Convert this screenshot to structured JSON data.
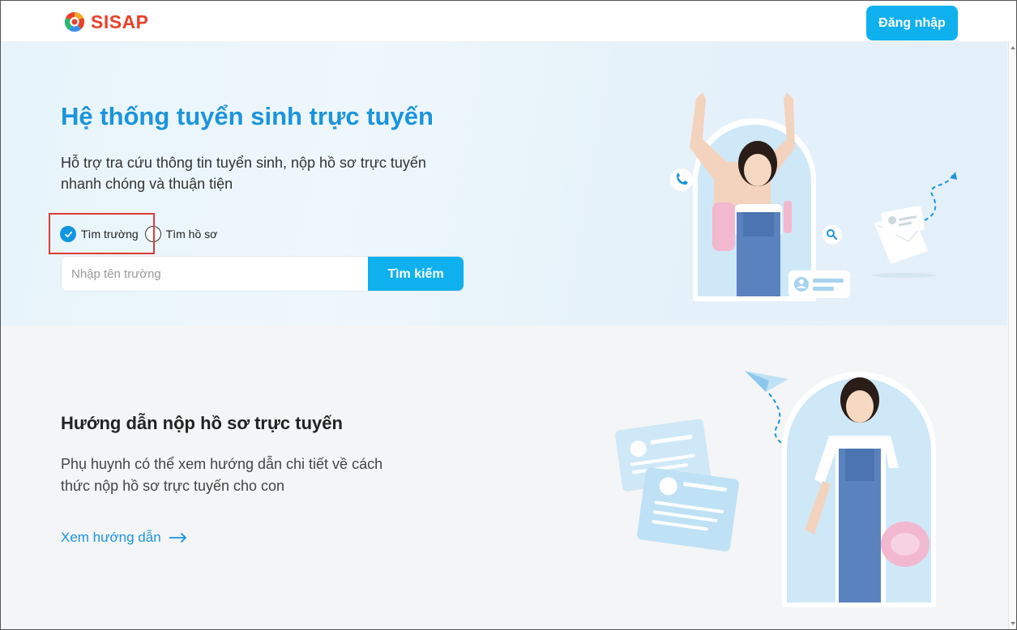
{
  "header": {
    "logo_text": "SISAP",
    "login_label": "Đăng nhập"
  },
  "hero": {
    "title": "Hệ thống tuyển sinh trực tuyến",
    "subtitle": "Hỗ trợ tra cứu thông tin tuyển sinh, nộp hồ sơ trực tuyến nhanh chóng và thuận tiện",
    "radios": [
      {
        "label": "Tìm trường",
        "checked": true
      },
      {
        "label": "Tìm hồ sơ",
        "checked": false
      }
    ],
    "search": {
      "placeholder": "Nhập tên trường",
      "value": "",
      "button_label": "Tìm kiếm"
    }
  },
  "guide": {
    "title": "Hướng dẫn nộp hồ sơ trực tuyến",
    "subtitle": "Phụ huynh có thể xem hướng dẫn chi tiết về cách thức nộp hồ sơ trực tuyến cho con",
    "link_label": "Xem hướng dẫn"
  },
  "colors": {
    "brand": "#0fb0ee",
    "title_blue": "#1b94dc",
    "logo_red": "#e8412b",
    "highlight": "#e03a3a"
  },
  "icons": [
    "sisap-logo-icon",
    "check-icon",
    "phone-icon",
    "search-icon",
    "user-card-icon",
    "envelope-icon",
    "paper-plane-icon",
    "arrow-right-icon"
  ]
}
